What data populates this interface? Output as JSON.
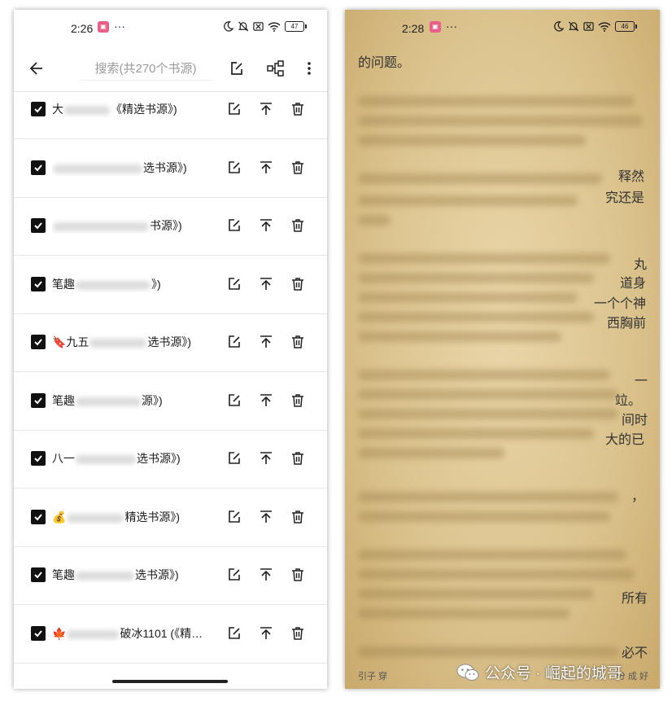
{
  "left": {
    "status": {
      "time": "2:26",
      "more": "···",
      "battery": "47"
    },
    "toolbar": {
      "search_placeholder": "搜索(共270个书源)"
    },
    "rows": [
      {
        "prefix": "大",
        "suffix": "《精选书源》)"
      },
      {
        "prefix": "",
        "suffix": "选书源》)"
      },
      {
        "prefix": "",
        "suffix": "书源》)"
      },
      {
        "prefix": "笔趣",
        "suffix": "》)"
      },
      {
        "prefix": "🔖九五",
        "suffix": "选书源》)"
      },
      {
        "prefix": "笔趣",
        "suffix": "源》)"
      },
      {
        "prefix": "八一",
        "suffix": "选书源》)"
      },
      {
        "prefix": "💰",
        "suffix": "精选书源》)"
      },
      {
        "prefix": "笔趣",
        "suffix": "选书源》)"
      },
      {
        "prefix": "🍁",
        "suffix": "破冰1101 (《精…"
      }
    ]
  },
  "right": {
    "status": {
      "time": "2:28",
      "more": "···",
      "battery": "46"
    },
    "text": {
      "frag1": "的问题。",
      "frag2": "释然",
      "frag3": "究还是",
      "frag4": "丸",
      "frag5": "道身",
      "frag6": "一个个神",
      "frag7": "西胸前",
      "frag8": "一",
      "frag9": "竝。",
      "frag10": "间时",
      "frag11": "大的已",
      "frag12": "，",
      "frag13": "所有",
      "frag14": "必不"
    },
    "footer": {
      "left": "引子 穿",
      "right": "分 成 好"
    }
  },
  "watermark": {
    "text": "公众号 · 崛起的城哥"
  }
}
